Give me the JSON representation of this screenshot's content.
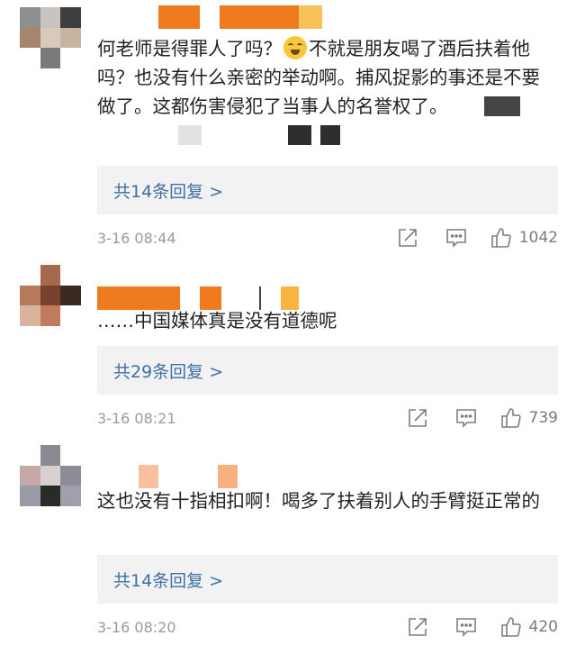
{
  "comments": [
    {
      "text_parts": [
        "何老师是得罪人了吗？",
        "不就是朋友喝了酒后扶着他吗？也没有什么亲密的举动啊。捕风捉影的事还是不要做了。这都伤害侵犯了当事人的名誉权了。"
      ],
      "emoji_icon": "crying-laugh-emoji-icon",
      "reply_label": "共14条回复 >",
      "time": "3-16 08:44",
      "likes": "1042"
    },
    {
      "text": "……中国媒体真是没有道德呢",
      "reply_label": "共29条回复 >",
      "time": "3-16 08:21",
      "likes": "739"
    },
    {
      "text": "这也没有十指相扣啊！喝多了扶着别人的手臂挺正常的",
      "reply_label": "共14条回复 >",
      "time": "3-16 08:20",
      "likes": "420"
    }
  ],
  "icons": {
    "share": "share-icon",
    "reply": "comment-icon",
    "like": "thumbs-up-icon"
  },
  "colors": {
    "link": "#3f6fa6",
    "reply_bg": "#f2f2f2",
    "username_mosaic": "#f07a1e"
  }
}
